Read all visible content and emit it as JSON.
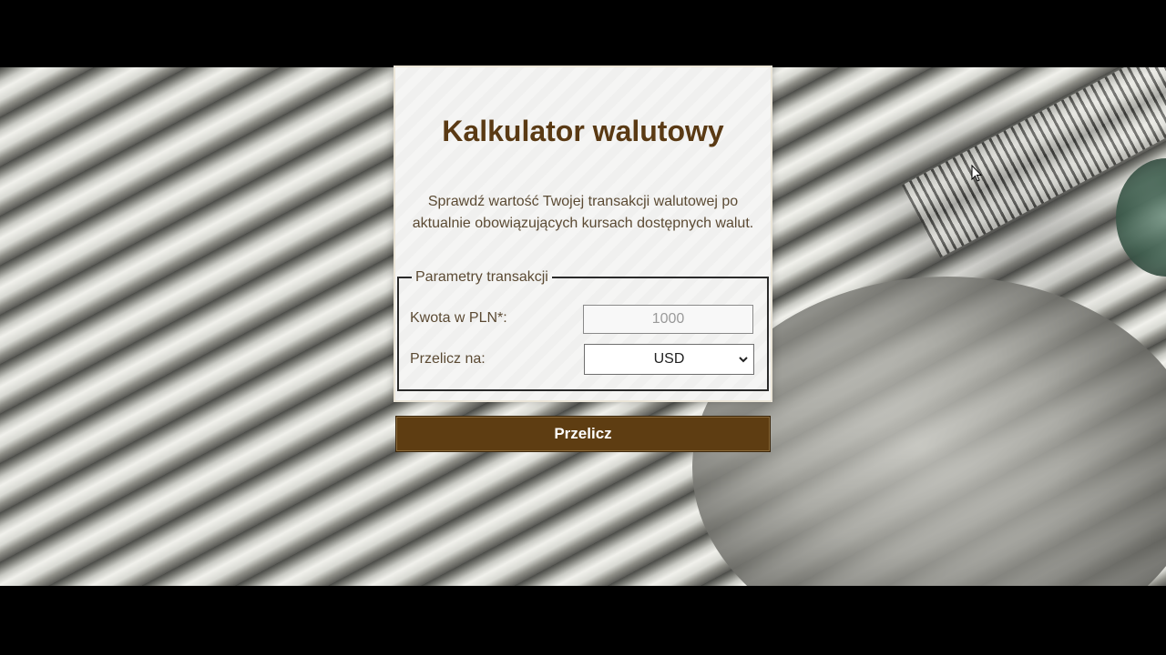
{
  "calculator": {
    "title": "Kalkulator walutowy",
    "description": "Sprawdź wartość Twojej transakcji walutowej po aktualnie obowiązujących kursach dostępnych walut."
  },
  "form": {
    "legend": "Parametry transakcji",
    "amount_label": "Kwota w PLN*:",
    "amount_placeholder": "1000",
    "convert_label": "Przelicz na:",
    "currency_selected": "USD",
    "submit_label": "Przelicz"
  },
  "icons": {
    "select_arrow": "chevron-down-icon",
    "pointer": "mouse-cursor-icon"
  },
  "colors": {
    "accent": "#5e3d12",
    "title": "#5a3a14",
    "text": "#5b4a33",
    "letterbox": "#000000"
  }
}
